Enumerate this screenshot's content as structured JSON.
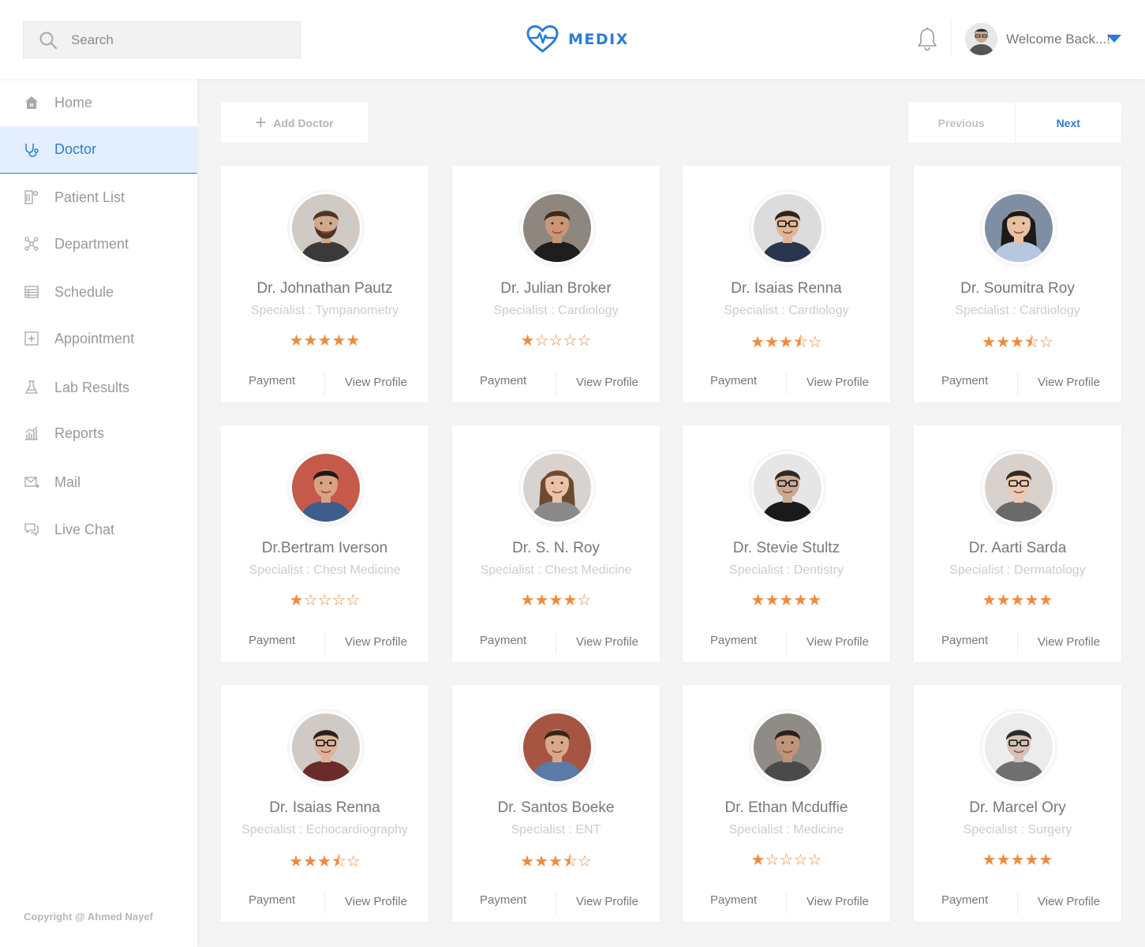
{
  "header": {
    "search_placeholder": "Search",
    "brand": "MEDIX",
    "welcome": "Welcome Back...!",
    "accent_color": "#2a7ddb"
  },
  "sidebar": {
    "items": [
      {
        "label": "Home",
        "icon": "home-icon",
        "active": false
      },
      {
        "label": "Doctor",
        "icon": "stethoscope-icon",
        "active": true
      },
      {
        "label": "Patient List",
        "icon": "patient-list-icon",
        "active": false
      },
      {
        "label": "Department",
        "icon": "department-icon",
        "active": false
      },
      {
        "label": "Schedule",
        "icon": "schedule-icon",
        "active": false
      },
      {
        "label": "Appointment",
        "icon": "appointment-icon",
        "active": false
      },
      {
        "label": "Lab Results",
        "icon": "flask-icon",
        "active": false
      },
      {
        "label": "Reports",
        "icon": "reports-icon",
        "active": false
      },
      {
        "label": "Mail",
        "icon": "mail-icon",
        "active": false
      },
      {
        "label": "Live Chat",
        "icon": "chat-icon",
        "active": false
      }
    ],
    "copyright": "Copyright @ Ahmed Nayef"
  },
  "toolbar": {
    "add_label": "Add Doctor",
    "prev_label": "Previous",
    "next_label": "Next"
  },
  "card_actions": {
    "payment": "Payment",
    "view_profile": "View Profile"
  },
  "doctors": [
    {
      "name": "Dr. Johnathan Pautz",
      "specialty": "Specialist : Tympanometry",
      "rating": 5
    },
    {
      "name": "Dr. Julian Broker",
      "specialty": "Specialist : Cardiology",
      "rating": 1
    },
    {
      "name": "Dr. Isaias Renna",
      "specialty": "Specialist : Cardiology",
      "rating": 3.5
    },
    {
      "name": "Dr. Soumitra Roy",
      "specialty": "Specialist : Cardiology",
      "rating": 3.5
    },
    {
      "name": "Dr.Bertram Iverson",
      "specialty": "Specialist : Chest Medicine",
      "rating": 1
    },
    {
      "name": "Dr. S. N. Roy",
      "specialty": "Specialist : Chest Medicine",
      "rating": 4
    },
    {
      "name": "Dr. Stevie Stultz",
      "specialty": "Specialist : Dentistry",
      "rating": 5
    },
    {
      "name": "Dr. Aarti Sarda",
      "specialty": "Specialist : Dermatology",
      "rating": 5
    },
    {
      "name": "Dr. Isaias Renna",
      "specialty": "Specialist : Echocardiography",
      "rating": 3.5
    },
    {
      "name": "Dr. Santos Boeke",
      "specialty": "Specialist : ENT",
      "rating": 3.5
    },
    {
      "name": "Dr. Ethan Mcduffie",
      "specialty": "Specialist : Medicine",
      "rating": 1
    },
    {
      "name": "Dr. Marcel Ory",
      "specialty": "Specialist : Surgery",
      "rating": 5
    }
  ]
}
